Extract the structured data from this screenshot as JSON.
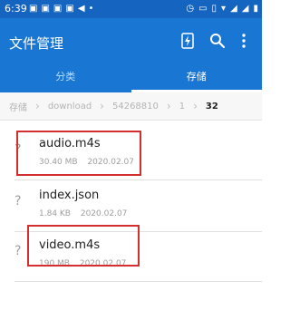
{
  "status_bar": {
    "time": "6:39",
    "left_icons": [
      "notification-icon",
      "notification-icon",
      "notification-icon",
      "notification-icon",
      "navigation-icon",
      "dot-icon"
    ],
    "right_icons": [
      "alarm-icon",
      "cast-icon",
      "vibrate-icon",
      "wifi-icon",
      "signal-icon",
      "signal-icon",
      "battery-icon"
    ]
  },
  "app_bar": {
    "title": "文件管理",
    "actions": [
      "flash-icon",
      "search-icon",
      "more-icon"
    ]
  },
  "tabs": [
    {
      "label": "分类",
      "active": false
    },
    {
      "label": "存储",
      "active": true
    }
  ],
  "breadcrumb": [
    "存储",
    "download",
    "54268810",
    "1",
    "32"
  ],
  "files": [
    {
      "name": "audio.m4s",
      "size": "30.40 MB",
      "date": "2020.02.07",
      "icon": "?"
    },
    {
      "name": "index.json",
      "size": "1.84 KB",
      "date": "2020.02.07",
      "icon": "?"
    },
    {
      "name": "video.m4s",
      "size": "190 MB",
      "date": "2020.02.07",
      "icon": "?"
    }
  ],
  "colors": {
    "status_bar": "#1565c0",
    "app_bar": "#1976d2",
    "highlight": "#d32f2f"
  }
}
